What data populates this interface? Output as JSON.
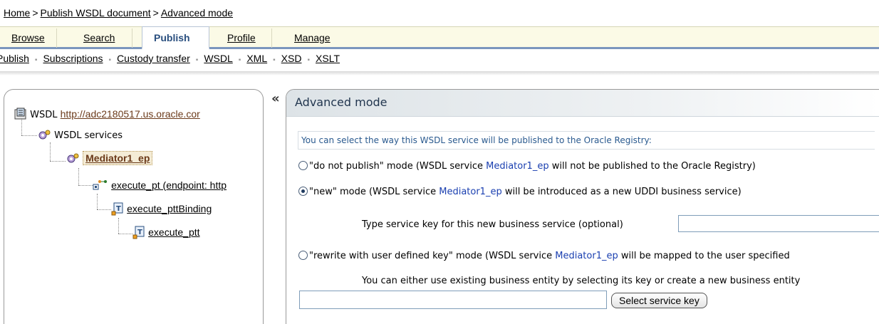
{
  "breadcrumb": {
    "items": [
      "Home",
      "Publish WSDL document",
      "Advanced mode"
    ],
    "separator": ">"
  },
  "tabs": [
    {
      "label": "Browse",
      "active": false
    },
    {
      "label": "Search",
      "active": false
    },
    {
      "label": "Publish",
      "active": true
    },
    {
      "label": "Profile",
      "active": false
    },
    {
      "label": "Manage",
      "active": false
    }
  ],
  "subnav": {
    "items": [
      "Publish",
      "Subscriptions",
      "Custody transfer",
      "WSDL",
      "XML",
      "XSD",
      "XSLT"
    ],
    "separator": "▪"
  },
  "tree": {
    "root_label": "WSDL",
    "root_link": "http://adc2180517.us.oracle.cor",
    "services_label": "WSDL services",
    "service": "Mediator1_ep",
    "port": "execute_pt (endpoint: http",
    "binding": "execute_pttBinding",
    "port_type": "execute_ptt"
  },
  "collapse_glyph": "«",
  "panel": {
    "title": "Advanced mode",
    "intro": "You can select the way this WSDL service will be published to the Oracle Registry:",
    "service_name": "Mediator1_ep",
    "options": [
      {
        "label": "\"do not publish\" mode",
        "pre": " (WSDL service ",
        "post": " will not be published to the Oracle Registry)",
        "checked": false
      },
      {
        "label": "\"new\" mode",
        "pre": " (WSDL service ",
        "post": " will be introduced as a new UDDI business service)",
        "checked": true
      },
      {
        "label": "\"rewrite with user defined key\" mode",
        "pre": " (WSDL service ",
        "post": " will be mapped to the user specified",
        "checked": false
      }
    ],
    "new_key_label": "Type service key for this new business service (optional)",
    "new_key_value": "",
    "entity_label": "You can either use existing business entity by selecting its key or create a new business entity",
    "user_key_value": "",
    "select_button": "Select service key"
  },
  "colors": {
    "accent": "#7b96bd",
    "service_link": "#1a3fb0",
    "intro_text": "#2a5a8f"
  }
}
